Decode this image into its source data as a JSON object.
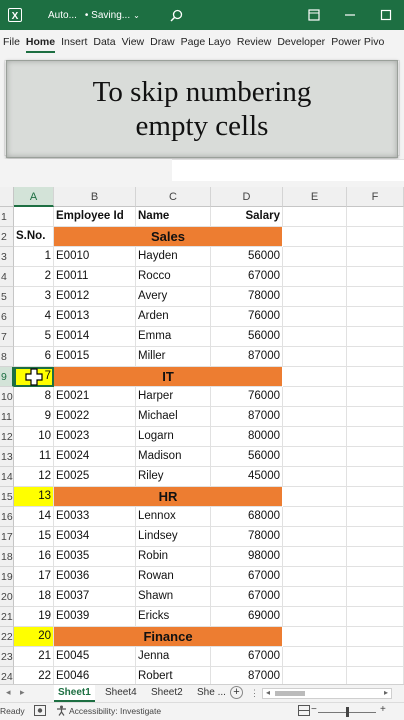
{
  "titlebar": {
    "doc_name": "Auto...",
    "status": "• Saving...",
    "chevron": "⌄"
  },
  "ribbon": {
    "tabs": [
      "File",
      "Home",
      "Insert",
      "Data",
      "View",
      "Draw",
      "Page Layo",
      "Review",
      "Developer",
      "Power Pivo"
    ],
    "active_tab": "Home"
  },
  "caption": {
    "line1": "To skip numbering",
    "line2": "empty cells"
  },
  "sheet": {
    "columns": [
      "A",
      "B",
      "C",
      "D",
      "E",
      "F"
    ],
    "rows": [
      {
        "n": "1",
        "b": "Employee Id",
        "c": "Name",
        "d": "Salary",
        "bold": true
      },
      {
        "n": "2",
        "a": "S.No.",
        "section": "Sales",
        "bold": true
      },
      {
        "n": "3",
        "a": "1",
        "b": "E0010",
        "c": "Hayden",
        "d": "56000"
      },
      {
        "n": "4",
        "a": "2",
        "b": "E0011",
        "c": "Rocco",
        "d": "67000"
      },
      {
        "n": "5",
        "a": "3",
        "b": "E0012",
        "c": "Avery",
        "d": "78000"
      },
      {
        "n": "6",
        "a": "4",
        "b": "E0013",
        "c": "Arden",
        "d": "76000"
      },
      {
        "n": "7",
        "a": "5",
        "b": "E0014",
        "c": "Emma",
        "d": "56000"
      },
      {
        "n": "8",
        "a": "6",
        "b": "E0015",
        "c": "Miller",
        "d": "87000"
      },
      {
        "n": "9",
        "a": "7",
        "section": "IT",
        "highlight": true,
        "selected": true
      },
      {
        "n": "10",
        "a": "8",
        "b": "E0021",
        "c": "Harper",
        "d": "76000"
      },
      {
        "n": "11",
        "a": "9",
        "b": "E0022",
        "c": "Michael",
        "d": "87000"
      },
      {
        "n": "12",
        "a": "10",
        "b": "E0023",
        "c": "Logarn",
        "d": "80000"
      },
      {
        "n": "13",
        "a": "11",
        "b": "E0024",
        "c": "Madison",
        "d": "56000"
      },
      {
        "n": "14",
        "a": "12",
        "b": "E0025",
        "c": "Riley",
        "d": "45000"
      },
      {
        "n": "15",
        "a": "13",
        "section": "HR",
        "highlight": true
      },
      {
        "n": "16",
        "a": "14",
        "b": "E0033",
        "c": "Lennox",
        "d": "68000"
      },
      {
        "n": "17",
        "a": "15",
        "b": "E0034",
        "c": "Lindsey",
        "d": "78000"
      },
      {
        "n": "18",
        "a": "16",
        "b": "E0035",
        "c": "Robin",
        "d": "98000"
      },
      {
        "n": "19",
        "a": "17",
        "b": "E0036",
        "c": "Rowan",
        "d": "67000"
      },
      {
        "n": "20",
        "a": "18",
        "b": "E0037",
        "c": "Shawn",
        "d": "67000"
      },
      {
        "n": "21",
        "a": "19",
        "b": "E0039",
        "c": "Ericks",
        "d": "69000"
      },
      {
        "n": "22",
        "a": "20",
        "section": "Finance",
        "highlight": true
      },
      {
        "n": "23",
        "a": "21",
        "b": "E0045",
        "c": "Jenna",
        "d": "67000"
      },
      {
        "n": "24",
        "a": "22",
        "b": "E0046",
        "c": "Robert",
        "d": "87000"
      }
    ]
  },
  "sheet_tabs": {
    "tabs": [
      "Sheet1",
      "Sheet4",
      "Sheet2",
      "She ..."
    ],
    "active": "Sheet1",
    "add": "+"
  },
  "statusbar": {
    "ready": "Ready",
    "accessibility": "Accessibility: Investigate"
  },
  "colors": {
    "excel_green": "#1d6f42",
    "section_orange": "#ed7d31",
    "highlight_yellow": "#ffff00"
  }
}
